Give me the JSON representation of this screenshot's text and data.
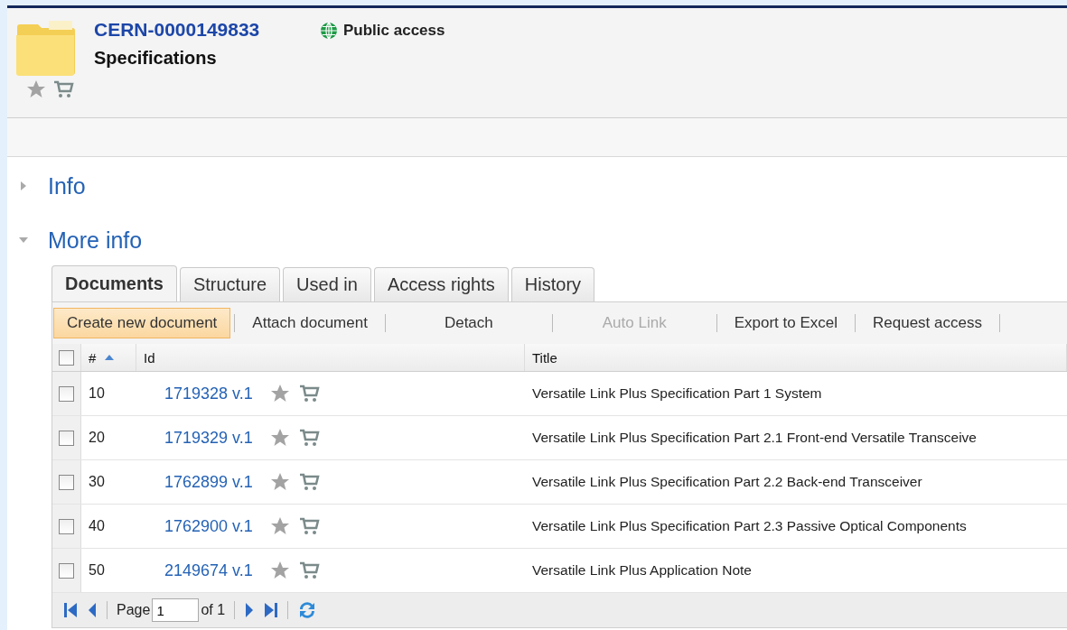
{
  "header": {
    "code": "CERN-0000149833",
    "name": "Specifications",
    "access": "Public access"
  },
  "sections": [
    {
      "title": "Info",
      "expanded": false
    },
    {
      "title": "More info",
      "expanded": true
    }
  ],
  "tabs": [
    {
      "label": "Documents",
      "selected": true
    },
    {
      "label": "Structure",
      "selected": false
    },
    {
      "label": "Used in",
      "selected": false
    },
    {
      "label": "Access rights",
      "selected": false
    },
    {
      "label": "History",
      "selected": false
    }
  ],
  "toolbar": [
    {
      "label": "Create new document",
      "highlighted": true,
      "disabled": false
    },
    {
      "label": "Attach document",
      "highlighted": false,
      "disabled": false
    },
    {
      "label": "Detach",
      "highlighted": false,
      "disabled": false
    },
    {
      "label": "Auto Link",
      "highlighted": false,
      "disabled": true
    },
    {
      "label": "Export to Excel",
      "highlighted": false,
      "disabled": false
    },
    {
      "label": "Request access",
      "highlighted": false,
      "disabled": false
    }
  ],
  "table": {
    "select_all": false,
    "columns": [
      {
        "label": "#",
        "sorted": true
      },
      {
        "label": "Id",
        "sorted": false
      },
      {
        "label": "Title",
        "sorted": false
      }
    ],
    "rows": [
      {
        "checked": false,
        "num": "10",
        "id": "1719328 v.1",
        "title": "Versatile Link Plus Specification Part 1 System"
      },
      {
        "checked": false,
        "num": "20",
        "id": "1719329 v.1",
        "title": "Versatile Link Plus Specification Part 2.1 Front-end Versatile Transceive"
      },
      {
        "checked": false,
        "num": "30",
        "id": "1762899 v.1",
        "title": "Versatile Link Plus Specification Part 2.2 Back-end Transceiver"
      },
      {
        "checked": false,
        "num": "40",
        "id": "1762900 v.1",
        "title": "Versatile Link Plus Specification Part 2.3 Passive Optical Components"
      },
      {
        "checked": false,
        "num": "50",
        "id": "2149674 v.1",
        "title": "Versatile Link Plus Application Note"
      }
    ]
  },
  "pager": {
    "page_label": "Page",
    "page": "1",
    "of": "of 1"
  }
}
